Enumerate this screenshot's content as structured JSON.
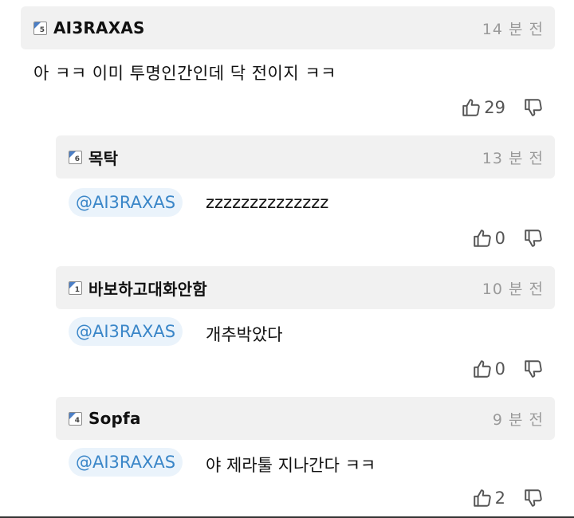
{
  "comments": [
    {
      "level": "5",
      "username": "AI3RAXAS",
      "time": "14 분 전",
      "text": "아 ㅋㅋ 이미 투명인간인데 닥 전이지 ㅋㅋ",
      "likes": "29"
    }
  ],
  "replies": [
    {
      "level": "6",
      "username": "목탁",
      "time": "13 분 전",
      "mention": "@AI3RAXAS",
      "text": "zzzzzzzzzzzzzz",
      "likes": "0"
    },
    {
      "level": "1",
      "username": "바보하고대화안함",
      "time": "10 분 전",
      "mention": "@AI3RAXAS",
      "text": "개추박았다",
      "likes": "0"
    },
    {
      "level": "4",
      "username": "Sopfa",
      "time": "9 분 전",
      "mention": "@AI3RAXAS",
      "text": "야 제라툴 지나간다 ㅋㅋ",
      "likes": "2"
    }
  ],
  "icons": {
    "like": "thumbs-up-icon",
    "dislike": "thumbs-down-icon",
    "level": "level-badge-icon"
  },
  "colors": {
    "mention_text": "#3a86c8",
    "mention_bg": "#eaf3fb",
    "header_bg": "#f1f1f1",
    "level_corner": "#4c7fc6"
  }
}
